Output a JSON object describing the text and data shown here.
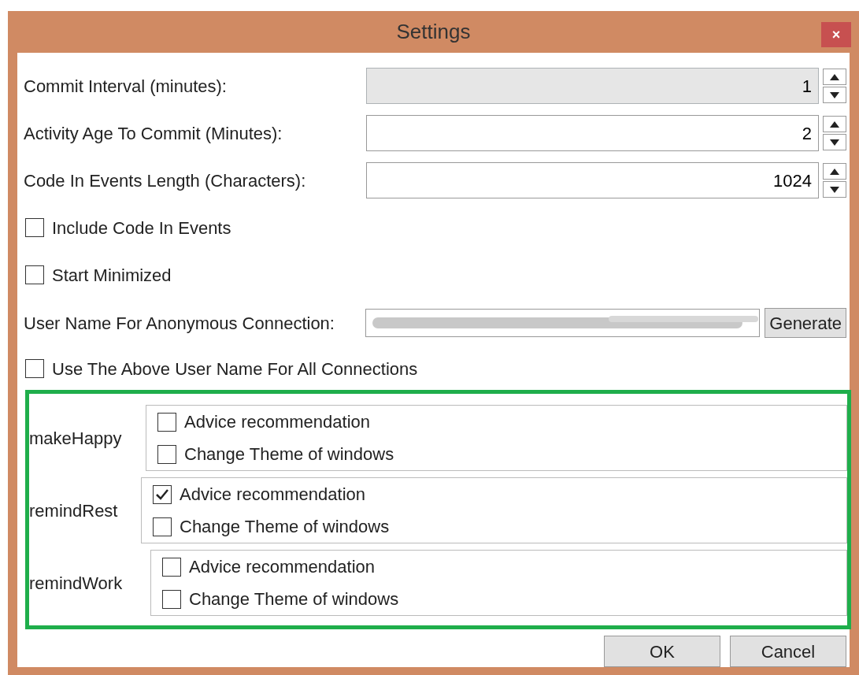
{
  "window": {
    "title": "Settings",
    "close": "×"
  },
  "numeric_fields": [
    {
      "label": "Commit Interval (minutes):",
      "value": "1",
      "disabled": true
    },
    {
      "label": "Activity Age To Commit (Minutes):",
      "value": "2",
      "disabled": false
    },
    {
      "label": "Code In Events Length (Characters):",
      "value": "1024",
      "disabled": false
    }
  ],
  "options": [
    {
      "label": "Include Code In Events",
      "checked": false
    },
    {
      "label": "Start Minimized",
      "checked": false
    }
  ],
  "user_name": {
    "label": "User Name For Anonymous Connection:",
    "value_redacted": true,
    "button": "Generate"
  },
  "use_for_all": {
    "label": "Use The Above User Name For All Connections",
    "checked": false
  },
  "groups": [
    {
      "name": "makeHappy",
      "items": [
        {
          "label": "Advice recommendation",
          "checked": false
        },
        {
          "label": "Change Theme of windows",
          "checked": false
        }
      ]
    },
    {
      "name": "remindRest",
      "items": [
        {
          "label": "Advice recommendation",
          "checked": true
        },
        {
          "label": "Change Theme of windows",
          "checked": false
        }
      ]
    },
    {
      "name": "remindWork",
      "items": [
        {
          "label": "Advice recommendation",
          "checked": false
        },
        {
          "label": "Change Theme of windows",
          "checked": false
        }
      ]
    }
  ],
  "buttons": [
    "OK",
    "Cancel"
  ]
}
